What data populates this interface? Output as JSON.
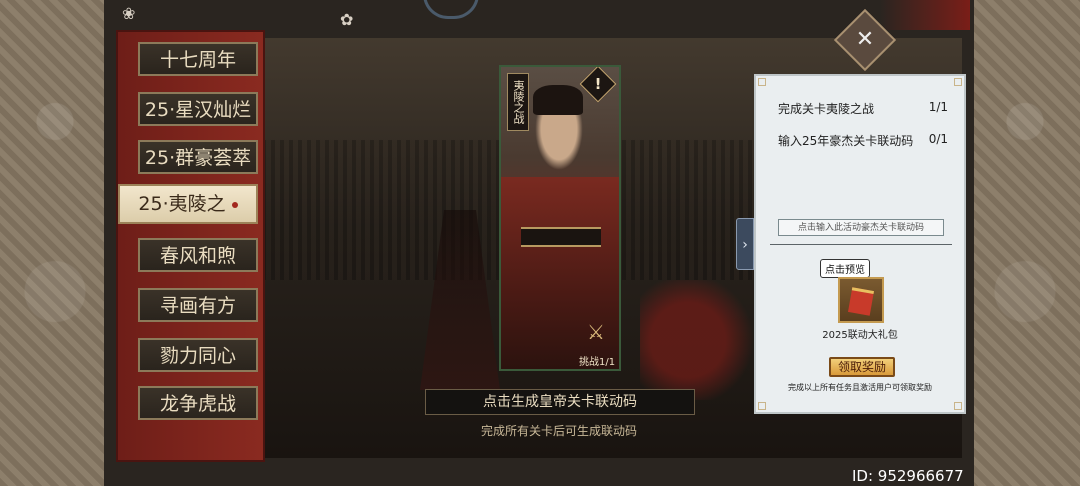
{
  "menu": {
    "items": [
      {
        "label": "十七周年"
      },
      {
        "label": "25·星汉灿烂"
      },
      {
        "label": "25·群豪荟萃"
      },
      {
        "label": "25·夷陵之"
      },
      {
        "label": "春风和煦"
      },
      {
        "label": "寻画有方"
      },
      {
        "label": "勠力同心"
      },
      {
        "label": "龙争虎战"
      }
    ],
    "active_index": 3
  },
  "card": {
    "title": "夷陵之战",
    "warning_icon": "!",
    "challenge": "挑战1/1"
  },
  "generate": {
    "button_label": "点击生成皇帝关卡联动码",
    "hint": "完成所有关卡后可生成联动码"
  },
  "tasks": [
    {
      "label": "完成关卡夷陵之战",
      "count": "1/1"
    },
    {
      "label": "输入25年豪杰关卡联动码",
      "count": "0/1"
    }
  ],
  "code_input": {
    "placeholder": "点击输入此活动豪杰关卡联动码"
  },
  "reward": {
    "preview_tip": "点击预览",
    "gift_label": "2025联动大礼包",
    "claim_button": "领取奖励",
    "claim_hint": "完成以上所有任务且激活用户可领取奖励"
  },
  "expand_icon": "›",
  "close_icon": "✕",
  "user_id": "ID: 952966677",
  "colors": {
    "menu_red": "#8a2a20",
    "panel_bg": "#eaeef0",
    "claim_gold": "#f2cf7a"
  }
}
